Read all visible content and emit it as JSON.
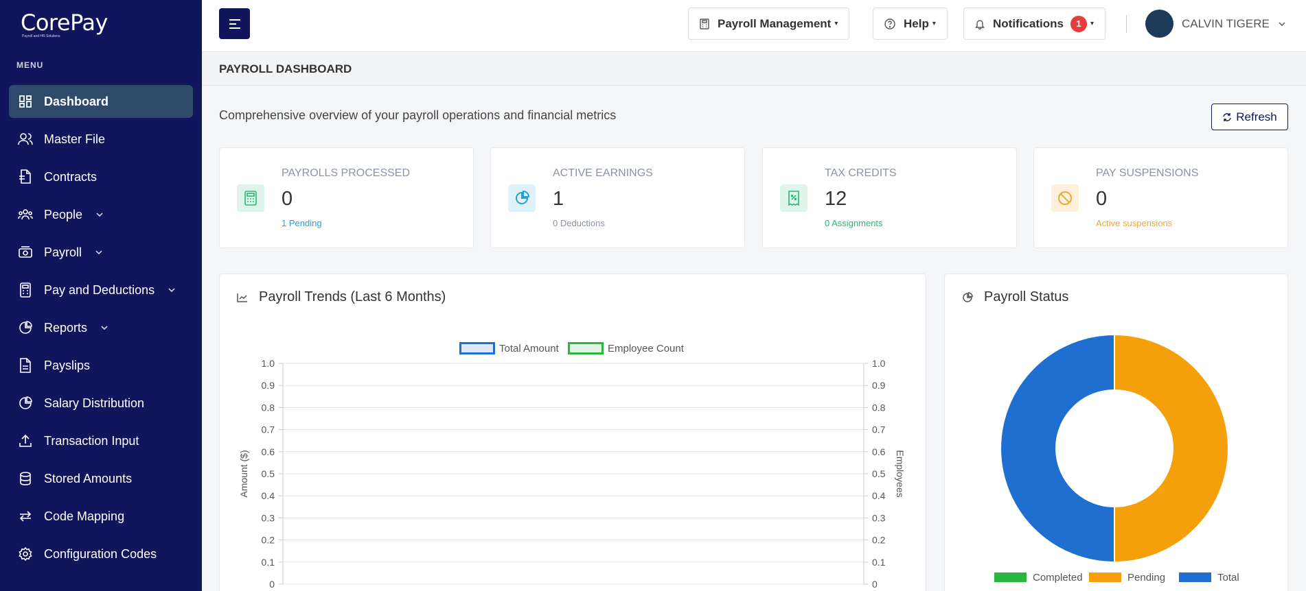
{
  "brand": {
    "name": "CorePay",
    "tagline": "Payroll and HR Solutions"
  },
  "sidebar": {
    "menu_label": "MENU",
    "items": [
      {
        "label": "Dashboard",
        "icon": "dashboard-icon"
      },
      {
        "label": "Master File",
        "icon": "users-icon"
      },
      {
        "label": "Contracts",
        "icon": "document-icon"
      },
      {
        "label": "People",
        "icon": "people-icon"
      },
      {
        "label": "Payroll",
        "icon": "payroll-icon"
      },
      {
        "label": "Pay and Deductions",
        "icon": "calculator-icon"
      },
      {
        "label": "Reports",
        "icon": "pie-chart-icon"
      },
      {
        "label": "Payslips",
        "icon": "file-icon"
      },
      {
        "label": "Salary Distribution",
        "icon": "pie-chart-icon"
      },
      {
        "label": "Transaction Input",
        "icon": "upload-icon"
      },
      {
        "label": "Stored Amounts",
        "icon": "database-icon"
      },
      {
        "label": "Code Mapping",
        "icon": "swap-icon"
      },
      {
        "label": "Configuration Codes",
        "icon": "gear-icon"
      }
    ]
  },
  "topbar": {
    "payroll_management": "Payroll Management",
    "help": "Help",
    "notifications": "Notifications",
    "notification_count": "1",
    "user_name": "CALVIN TIGERE"
  },
  "page": {
    "title": "PAYROLL DASHBOARD",
    "subtitle": "Comprehensive overview of your payroll operations and financial metrics",
    "refresh": "Refresh"
  },
  "cards": [
    {
      "label": "PAYROLLS PROCESSED",
      "value": "0",
      "sub": "1 Pending",
      "sub_color": "#2a9fd6",
      "icon_bg": "#dff5ea",
      "icon_color": "#2bb673"
    },
    {
      "label": "ACTIVE EARNINGS",
      "value": "1",
      "sub": "0 Deductions",
      "sub_color": "#8a93a3",
      "icon_bg": "#dff1fa",
      "icon_color": "#2a9fd6"
    },
    {
      "label": "TAX CREDITS",
      "value": "12",
      "sub": "0 Assignments",
      "sub_color": "#2bb673",
      "icon_bg": "#dff5ea",
      "icon_color": "#2bb673"
    },
    {
      "label": "PAY SUSPENSIONS",
      "value": "0",
      "sub": "Active suspensions",
      "sub_color": "#f0a830",
      "icon_bg": "#fdf1dc",
      "icon_color": "#f0a830"
    }
  ],
  "chart_data": [
    {
      "type": "line",
      "title": "Payroll Trends (Last 6 Months)",
      "series": [
        {
          "name": "Total Amount",
          "values": [],
          "color": "#1f6fd1"
        },
        {
          "name": "Employee Count",
          "values": [],
          "color": "#2bb63f"
        }
      ],
      "ylabel": "Amount ($)",
      "y2label": "Employees",
      "ylim": [
        0,
        1.0
      ],
      "y2lim": [
        0,
        1.0
      ],
      "yticks": [
        "1.0",
        "0.9",
        "0.8",
        "0.7",
        "0.6",
        "0.5",
        "0.4",
        "0.3",
        "0.2",
        "0.1",
        "0"
      ],
      "grid": true,
      "legend": "top"
    },
    {
      "type": "pie",
      "title": "Payroll Status",
      "donut": true,
      "categories": [
        "Completed",
        "Pending",
        "Total"
      ],
      "values": [
        0,
        1,
        1
      ],
      "colors": [
        "#2bb63f",
        "#f5a00a",
        "#1f6fd1"
      ],
      "legend": "bottom"
    }
  ]
}
